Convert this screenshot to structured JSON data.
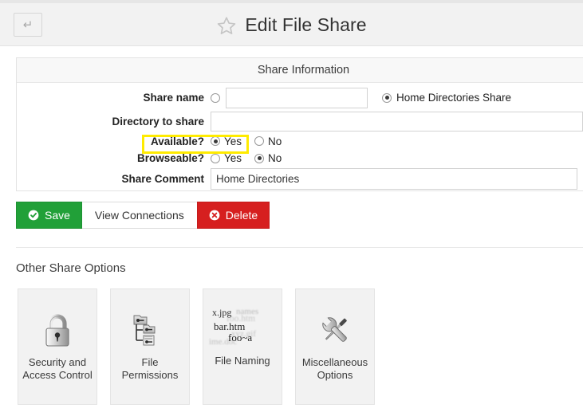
{
  "header": {
    "back_label": "↵",
    "back_icon": "back-arrow-icon",
    "star_icon": "star-outline-icon",
    "title": "Edit File Share"
  },
  "share_information": {
    "panel_title": "Share Information",
    "share_name": {
      "label": "Share name",
      "custom_radio_selected": false,
      "input_value": "",
      "input_placeholder": "",
      "preset_radio_selected": true,
      "preset_label": "Home Directories Share"
    },
    "directory_to_share": {
      "label": "Directory to share",
      "value": "",
      "placeholder": ""
    },
    "available": {
      "label": "Available?",
      "yes_label": "Yes",
      "no_label": "No",
      "selected": "Yes"
    },
    "browseable": {
      "label": "Browseable?",
      "yes_label": "Yes",
      "no_label": "No",
      "selected": "No"
    },
    "share_comment": {
      "label": "Share Comment",
      "value": "Home Directories",
      "placeholder": ""
    }
  },
  "actions": {
    "save_label": "Save",
    "save_icon": "check-circle-icon",
    "save_color": "#21a038",
    "view_connections_label": "View Connections",
    "delete_label": "Delete",
    "delete_icon": "x-circle-icon",
    "delete_color": "#d61f1f"
  },
  "other_share_options": {
    "section_title": "Other Share Options",
    "cards": [
      {
        "label": "Security and\nAccess Control",
        "label_line1": "Security and",
        "label_line2": "Access Control",
        "icon": "padlock-icon"
      },
      {
        "label": "File\nPermissions",
        "label_line1": "File",
        "label_line2": "Permissions",
        "icon": "folder-tree-key-icon"
      },
      {
        "label": "File Naming",
        "label_line1": "File Naming",
        "label_line2": "",
        "icon": "filenames-text-icon",
        "icon_text": {
          "faint_1": "names",
          "faint_2": "foo.htm",
          "faint_3": "xyz.gif",
          "faint_4": "ime.doc",
          "sharp_1": "x.jpg",
          "sharp_2": "bar.htm",
          "sharp_3": "foo~a"
        }
      },
      {
        "label": "Miscellaneous\nOptions",
        "label_line1": "Miscellaneous",
        "label_line2": "Options",
        "icon": "wrench-screwdriver-icon"
      }
    ]
  },
  "annotation": {
    "highlight_color": "#ffeb00",
    "highlight_target": "available-yes-radio"
  }
}
